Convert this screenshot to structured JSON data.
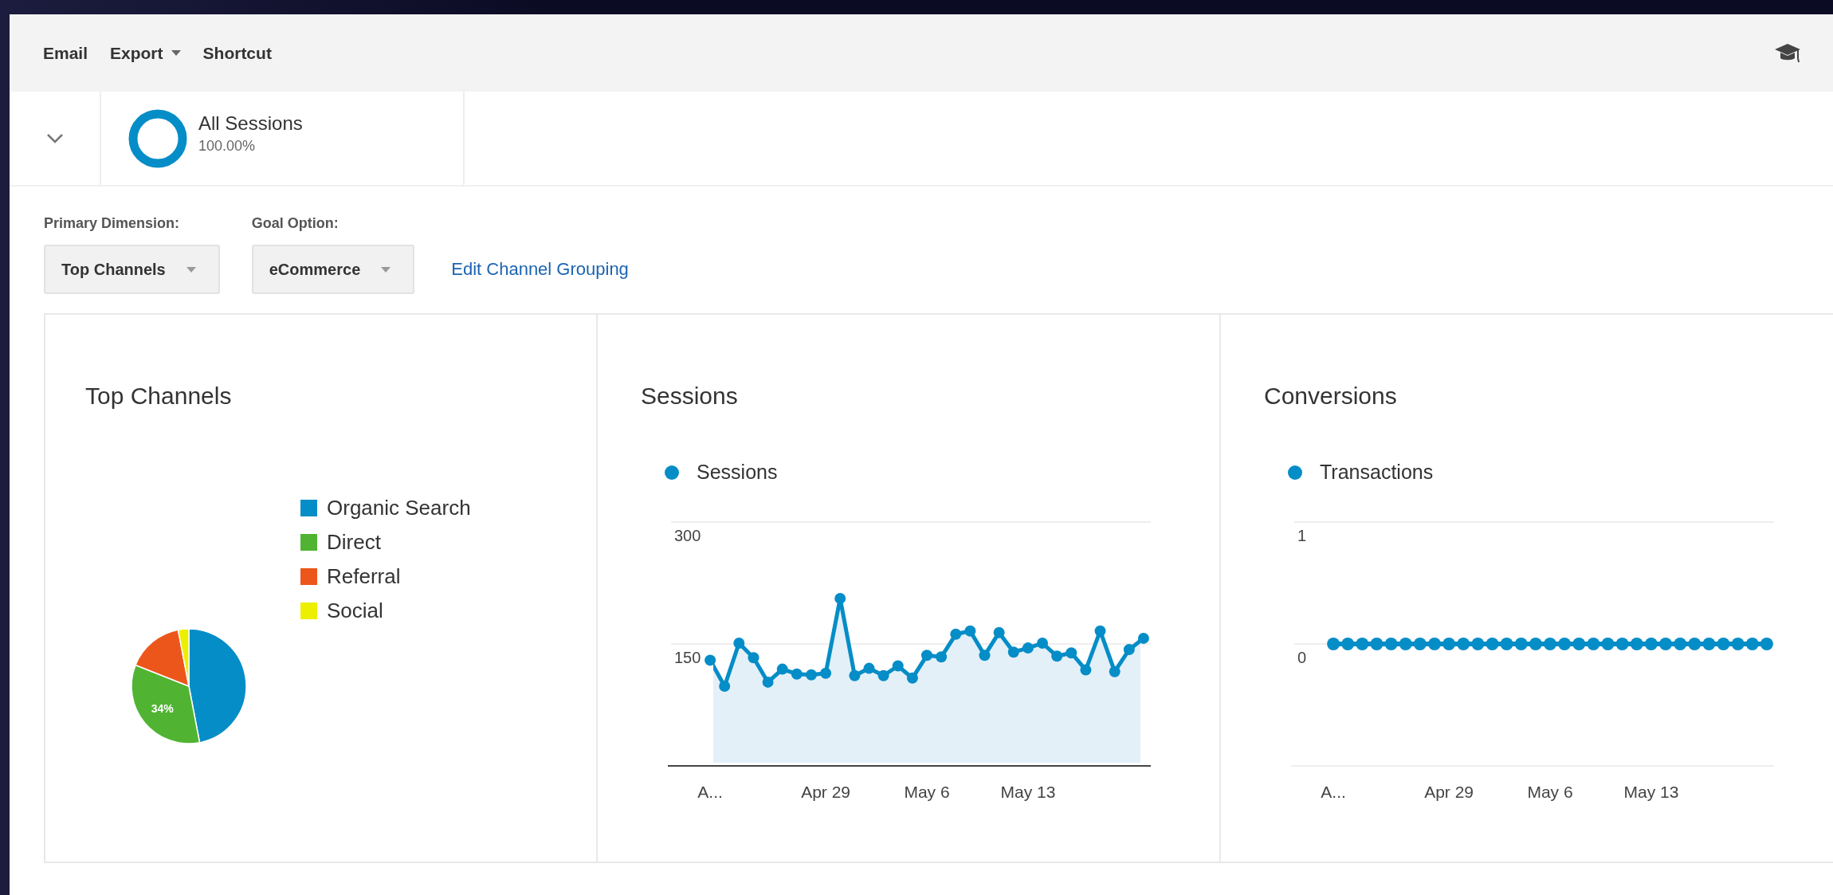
{
  "toolbar": {
    "actions": [
      {
        "label": "Email",
        "has_menu": false
      },
      {
        "label": "Export",
        "has_menu": true
      },
      {
        "label": "Shortcut",
        "has_menu": false
      }
    ]
  },
  "segment": {
    "name": "All Sessions",
    "share": "100.00%"
  },
  "options": [
    {
      "label": "Primary Dimension:",
      "value": "Top Channels"
    },
    {
      "label": "Goal Option:",
      "value": "eCommerce"
    }
  ],
  "link": "Edit Channel Grouping",
  "cards": [
    {
      "kind": "pie",
      "title": "Top Channels",
      "chart_data": {
        "type": "pie",
        "categories": [
          "Organic Search",
          "Direct",
          "Referral",
          "Social"
        ],
        "values": [
          47,
          34,
          16,
          3
        ],
        "colors": [
          "#058dc7",
          "#50b432",
          "#ed561b",
          "#edef00"
        ],
        "value_labels": [
          null,
          "34%",
          null,
          null
        ]
      }
    },
    {
      "kind": "line",
      "title": "Sessions",
      "chart_data": {
        "type": "area",
        "series": [
          {
            "name": "Sessions",
            "color": "#058dc7",
            "marker": true,
            "values": [
              130,
              98,
              151,
              133,
              103,
              119,
              113,
              112,
              114,
              206,
              111,
              120,
              111,
              123,
              108,
              136,
              134,
              162,
              166,
              136,
              164,
              140,
              145,
              151,
              135,
              139,
              118,
              166,
              116,
              143,
              157
            ]
          }
        ],
        "ylim": [
          0,
          300
        ],
        "yticks": [
          150,
          300
        ],
        "categories": [
          "A...",
          null,
          null,
          null,
          null,
          null,
          null,
          null,
          "Apr 29",
          null,
          null,
          null,
          null,
          null,
          null,
          "May 6",
          null,
          null,
          null,
          null,
          null,
          null,
          "May 13",
          null,
          null,
          null,
          null,
          null,
          null,
          null,
          null
        ]
      }
    },
    {
      "kind": "line",
      "title": "Conversions",
      "chart_data": {
        "type": "line",
        "series": [
          {
            "name": "Transactions",
            "color": "#058dc7",
            "marker": true,
            "values": [
              0,
              0,
              0,
              0,
              0,
              0,
              0,
              0,
              0,
              0,
              0,
              0,
              0,
              0,
              0,
              0,
              0,
              0,
              0,
              0,
              0,
              0,
              0,
              0,
              0,
              0,
              0,
              0,
              0,
              0,
              0
            ]
          }
        ],
        "ylim": [
          -1,
          1
        ],
        "yticks": [
          0,
          1
        ],
        "categories": [
          "A...",
          null,
          null,
          null,
          null,
          null,
          null,
          null,
          "Apr 29",
          null,
          null,
          null,
          null,
          null,
          null,
          "May 6",
          null,
          null,
          null,
          null,
          null,
          null,
          "May 13",
          null,
          null,
          null,
          null,
          null,
          null,
          null,
          null
        ]
      }
    }
  ]
}
